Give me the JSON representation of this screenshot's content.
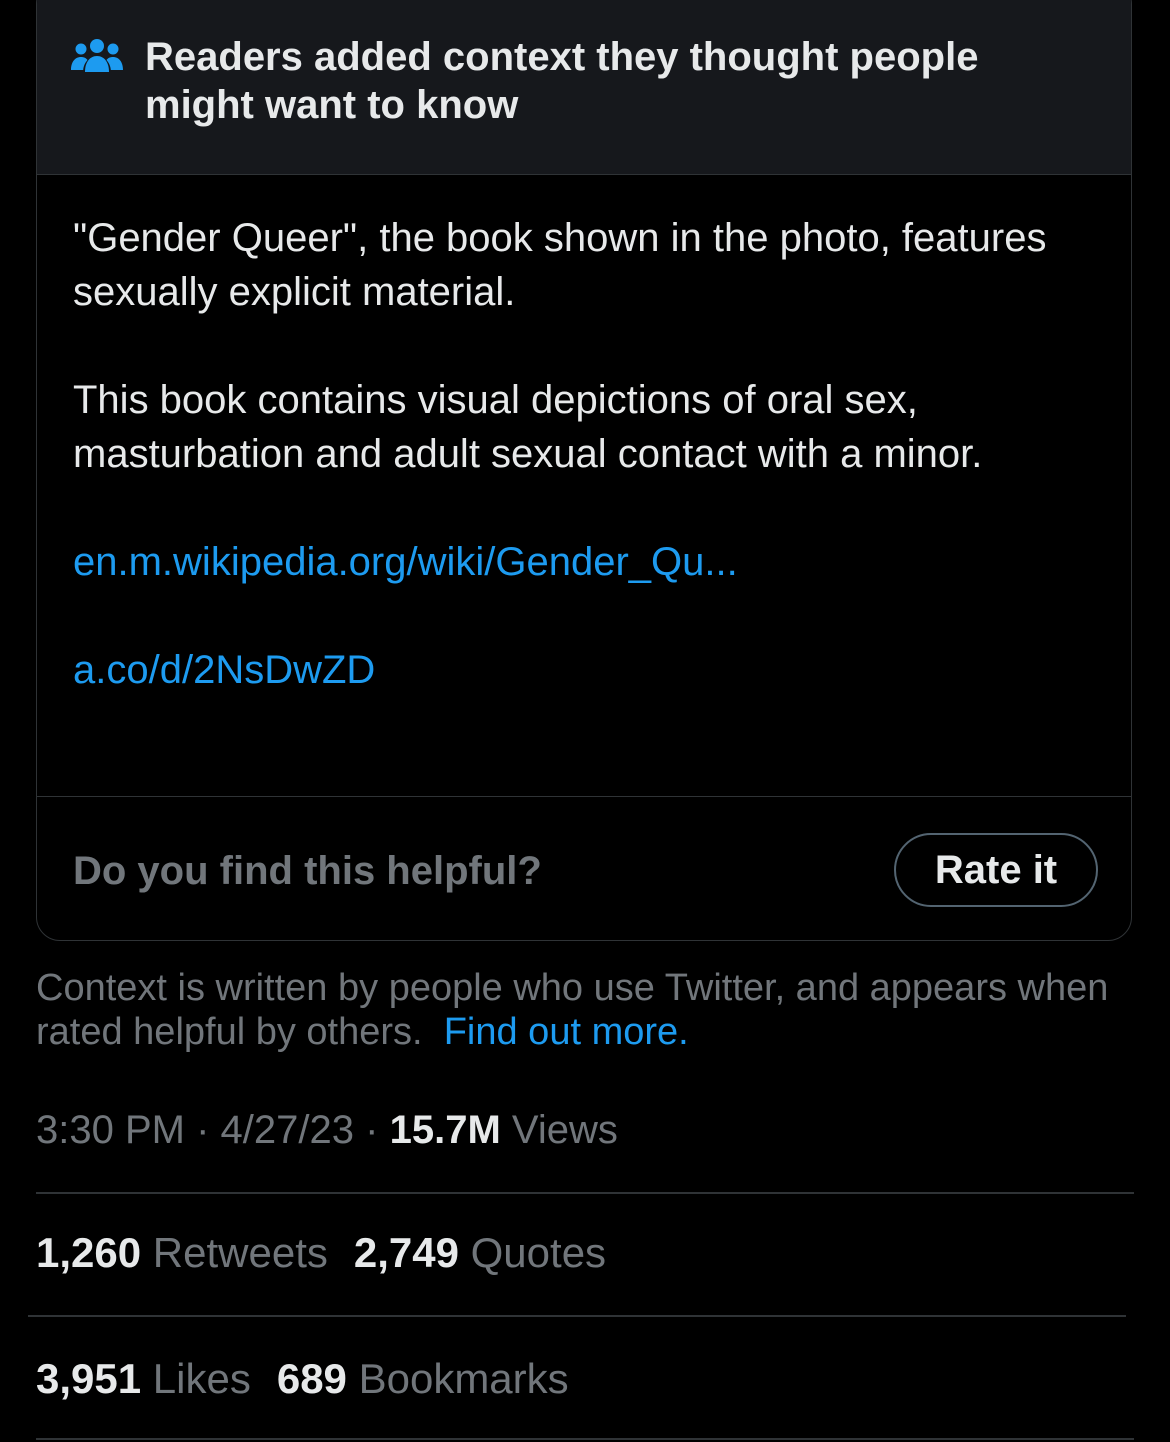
{
  "note": {
    "header_title": "Readers added context they thought people might want to know",
    "header_icon": "people-icon",
    "accent_color": "#1d9bf0",
    "paragraph_1": "\"Gender Queer\", the book shown in the photo, features sexually explicit material.",
    "paragraph_2": "This book contains visual depictions of oral sex, masturbation and adult sexual contact with a minor.",
    "link_1": "en.m.wikipedia.org/wiki/Gender_Qu...",
    "link_2": "a.co/d/2NsDwZD",
    "helpful_question": "Do you find this helpful?",
    "rate_button_label": "Rate it"
  },
  "disclaimer": {
    "text": "Context is written by people who use Twitter, and appears when rated helpful by others.",
    "link_label": "Find out more."
  },
  "meta": {
    "time": "3:30 PM",
    "separator": "·",
    "date": "4/27/23",
    "views_count": "15.7M",
    "views_label": "Views"
  },
  "stats": {
    "retweets_count": "1,260",
    "retweets_label": "Retweets",
    "quotes_count": "2,749",
    "quotes_label": "Quotes",
    "likes_count": "3,951",
    "likes_label": "Likes",
    "bookmarks_count": "689",
    "bookmarks_label": "Bookmarks"
  }
}
